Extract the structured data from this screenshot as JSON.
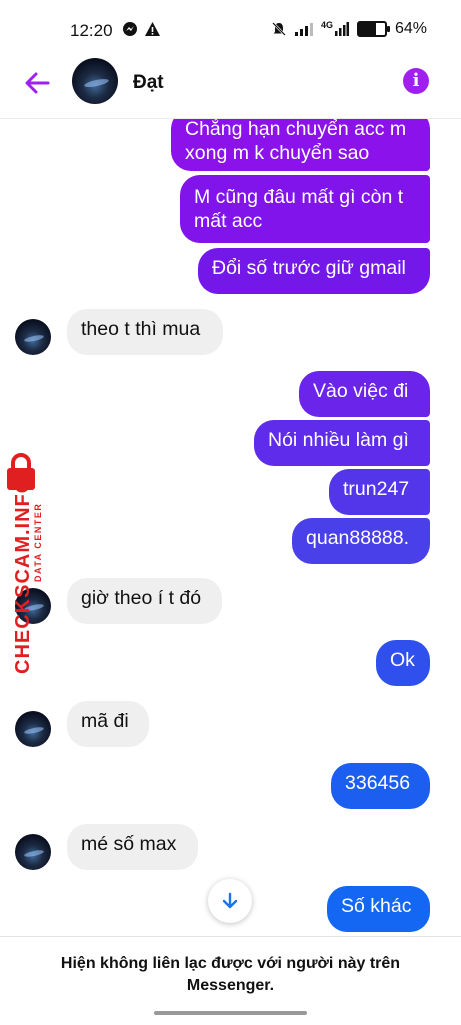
{
  "status_bar": {
    "time": "12:20",
    "network": "4G",
    "battery": "64%",
    "battery_level": 0.64
  },
  "header": {
    "contact_name": "Đạt",
    "icons": [
      "back-arrow-icon",
      "avatar",
      "info-icon"
    ],
    "accent_color": "#a020f0"
  },
  "messages": [
    {
      "side": "out",
      "text": "Chẳng hạn chuyển acc m\nxong m k chuyển sao",
      "color": "#8b12ea"
    },
    {
      "side": "out",
      "text": "M cũng đâu mất gì còn t\nmất acc",
      "color": "#8014ea"
    },
    {
      "side": "out",
      "text": "Đổi số trước giữ gmail",
      "color": "#7418ea"
    },
    {
      "side": "in",
      "text": "theo t thì mua"
    },
    {
      "side": "out",
      "text": "Vào việc đi",
      "color": "#6a24ea"
    },
    {
      "side": "out",
      "text": "Nói nhiều làm gì",
      "color": "#5e2cea"
    },
    {
      "side": "out",
      "text": "trun247",
      "color": "#5436ea"
    },
    {
      "side": "out",
      "text": "quan88888.",
      "color": "#4a40ea"
    },
    {
      "side": "in",
      "text": "giờ theo í t đó"
    },
    {
      "side": "out",
      "text": "Ok",
      "color": "#2f50ec"
    },
    {
      "side": "in",
      "text": "mã đi"
    },
    {
      "side": "out",
      "text": "336456",
      "color": "#1c5ff0"
    },
    {
      "side": "in",
      "text": "mé số max"
    },
    {
      "side": "out",
      "text": "Số khác",
      "color": "#1467f2"
    }
  ],
  "footer": {
    "notice": "Hiện không liên lạc được với người này trên\nMessenger."
  },
  "watermark": {
    "brand": "CHECKSCAM.INFO",
    "tagline": "DATA CENTER"
  }
}
